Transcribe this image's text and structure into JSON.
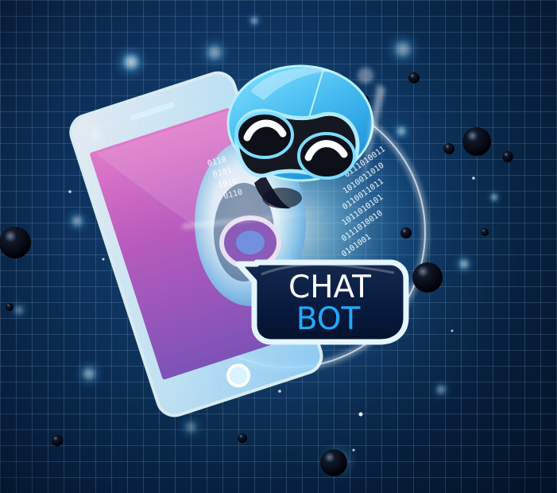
{
  "scene": {
    "label_line_1": "CHAT",
    "label_line_2": "BOT",
    "binary_left": [
      "0110",
      "0101",
      "1010",
      "0110"
    ],
    "binary_right": [
      "0111010011",
      "1010011010",
      "0110011011",
      "1011010101",
      "0111010010",
      "0101001"
    ],
    "colors": {
      "background": "#071e38",
      "grid": "#dff4ff",
      "robot": "#48b9ee",
      "bubble": "#071a3e",
      "bot_text": "#22a9ff"
    },
    "icons": [
      "smartphone-icon",
      "robot-icon",
      "chat-bubble-icon",
      "glow-orb-icon"
    ]
  }
}
